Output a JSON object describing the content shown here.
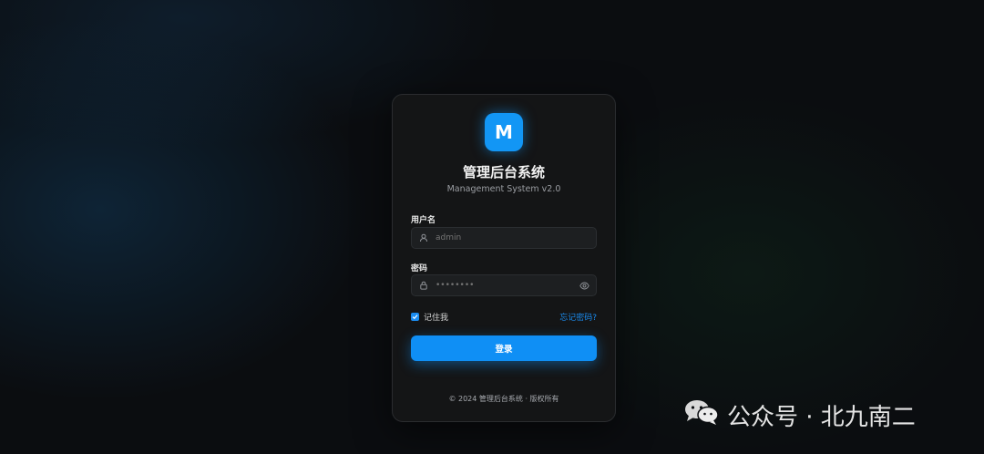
{
  "logo": {
    "letter": "M",
    "color": "#1296f5"
  },
  "header": {
    "title": "管理后台系统",
    "subtitle": "Management System v2.0"
  },
  "username": {
    "label": "用户名",
    "placeholder": "admin",
    "icon": "user-icon"
  },
  "password": {
    "label": "密码",
    "placeholder": "••••••••",
    "icon": "lock-icon",
    "toggle_icon": "eye-icon"
  },
  "remember": {
    "label": "记住我",
    "checked": true
  },
  "forgot": {
    "label": "忘记密码?"
  },
  "login": {
    "label": "登录",
    "color": "#0f8ff5"
  },
  "footer": {
    "text": "© 2024 管理后台系统 · 版权所有"
  },
  "watermark": {
    "text": "公众号 · 北九南二",
    "icon": "wechat-icon"
  }
}
